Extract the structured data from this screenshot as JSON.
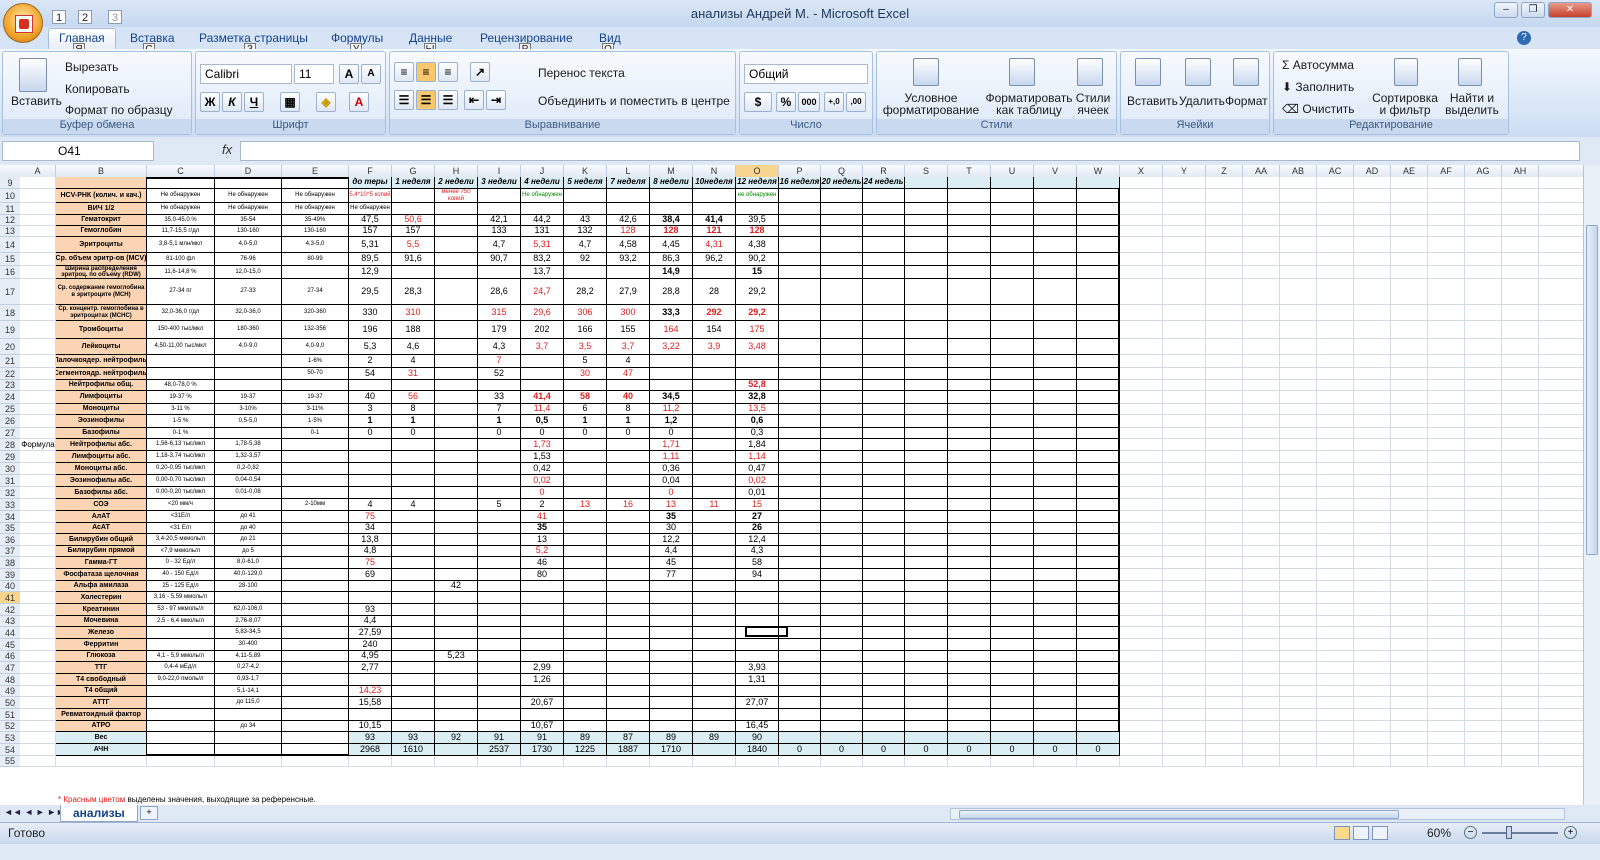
{
  "window": {
    "title": "анализы Андрей М. - Microsoft Excel",
    "qa": [
      "1",
      "2",
      "3"
    ]
  },
  "tabs": [
    {
      "label": "Главная",
      "key": "Я"
    },
    {
      "label": "Вставка",
      "key": "С"
    },
    {
      "label": "Разметка страницы",
      "key": "З"
    },
    {
      "label": "Формулы",
      "key": "У"
    },
    {
      "label": "Данные",
      "key": "Ы"
    },
    {
      "label": "Рецензирование",
      "key": "Р"
    },
    {
      "label": "Вид",
      "key": "О"
    }
  ],
  "ribbon": {
    "clipboard": {
      "paste": "Вставить",
      "cut": "Вырезать",
      "copy": "Копировать",
      "painter": "Формат по образцу",
      "label": "Буфер обмена"
    },
    "font": {
      "name": "Calibri",
      "size": "11",
      "label": "Шрифт",
      "bold": "Ж",
      "italic": "К",
      "underline": "Ч"
    },
    "align": {
      "wrap": "Перенос текста",
      "merge": "Объединить и поместить в центре",
      "label": "Выравнивание"
    },
    "number": {
      "format": "Общий",
      "label": "Число",
      "pct": "%",
      "thousands": "000",
      "inc": "+,0",
      "dec": ",00"
    },
    "styles": {
      "cond": "Условное форматирование",
      "table": "Форматировать как таблицу",
      "cell": "Стили ячеек",
      "label": "Стили"
    },
    "cells": {
      "insert": "Вставить",
      "delete": "Удалить",
      "format": "Формат",
      "label": "Ячейки"
    },
    "editing": {
      "autosum": "Автосумма",
      "fill": "Заполнить",
      "clear": "Очистить",
      "sort": "Сортировка и фильтр",
      "find": "Найти и выделить",
      "label": "Редактирование"
    }
  },
  "formula": {
    "namebox": "O41",
    "fx": "fx",
    "value": ""
  },
  "columns": [
    "A",
    "B",
    "C",
    "D",
    "E",
    "F",
    "G",
    "H",
    "I",
    "J",
    "K",
    "L",
    "M",
    "N",
    "O",
    "P",
    "Q",
    "R",
    "S",
    "T",
    "U",
    "V",
    "W",
    "X",
    "Y",
    "Z",
    "AA",
    "AB",
    "AC",
    "AD",
    "AE",
    "AF",
    "AG",
    "AH"
  ],
  "header_row": [
    "до теры",
    "1 неделя",
    "2 недели",
    "3 недели",
    "4 недели",
    "5 неделя",
    "7 неделя",
    "8 недели",
    "10неделя",
    "12 неделя",
    "16 неделя",
    "20 недель",
    "24 недель"
  ],
  "rows": [
    {
      "n": "10",
      "b": "HCV-РНК (колич. и кач.)",
      "c": "Не обнаружен",
      "d": "Не обнаружен",
      "e": "Не обнаружен",
      "vals": {
        "F": "5,4*10^5 копий",
        "H": "менее 750 копий",
        "J": "Не обнаружен",
        "O": "не обнаружен"
      }
    },
    {
      "n": "11",
      "b": "ВИЧ 1/2",
      "c": "Не обнаружен",
      "d": "Не обнаружен",
      "e": "Не обнаружен",
      "vals": {
        "F": "Не обнаружен"
      }
    },
    {
      "n": "12",
      "b": "Гематокрит",
      "c": "35,0-45,0 %",
      "d": "35-54",
      "e": "35-49%",
      "vals": {
        "F": "47,5",
        "G": "50,6",
        "I": "42,1",
        "J": "44,2",
        "K": "43",
        "L": "42,6",
        "M": "38,4",
        "N": "41,4",
        "O": "39,5"
      }
    },
    {
      "n": "13",
      "b": "Гемоглобин",
      "c": "11,7-15,5 г/дл",
      "d": "130-160",
      "e": "130-160",
      "vals": {
        "F": "157",
        "G": "157",
        "I": "133",
        "J": "131",
        "K": "132",
        "L": "128",
        "M": "128",
        "N": "121",
        "O": "128"
      }
    },
    {
      "n": "14",
      "b": "Эритроциты",
      "c": "3,8-5,1 млн/мкл",
      "d": "4,0-5,0",
      "e": "4,3-5,0",
      "vals": {
        "F": "5,31",
        "G": "5,5",
        "I": "4,7",
        "J": "5,31",
        "K": "4,7",
        "L": "4,58",
        "M": "4,45",
        "N": "4,31",
        "O": "4,38"
      }
    },
    {
      "n": "15",
      "b": "Ср. объем эритр-ов (MCV)",
      "c": "81-100 фл",
      "d": "76-96",
      "e": "80-99",
      "vals": {
        "F": "89,5",
        "G": "91,6",
        "I": "90,7",
        "J": "83,2",
        "K": "92",
        "L": "93,2",
        "M": "86,3",
        "N": "96,2",
        "O": "90,2"
      }
    },
    {
      "n": "16",
      "b": "Ширина распределения эритроц. по объему (RDW)",
      "c": "11,6-14,8 %",
      "d": "12,0-15,0",
      "e": "",
      "vals": {
        "F": "12,9",
        "J": "13,7",
        "M": "14,9",
        "O": "15"
      }
    },
    {
      "n": "17",
      "b": "Ср. содержание гемоглобина в эритроците (MCH)",
      "c": "27-34 пг",
      "d": "27-33",
      "e": "27-34",
      "vals": {
        "F": "29,5",
        "G": "28,3",
        "I": "28,6",
        "J": "24,7",
        "K": "28,2",
        "L": "27,9",
        "M": "28,8",
        "N": "28",
        "O": "29,2"
      }
    },
    {
      "n": "18",
      "b": "Ср. концентр. гемоглобина в эритроцитах (MCHC)",
      "c": "32,0-36,0 г/дл",
      "d": "32,0-36,0",
      "e": "320-360",
      "vals": {
        "F": "330",
        "G": "310",
        "I": "315",
        "J": "29,6",
        "K": "306",
        "L": "300",
        "M": "33,3",
        "N": "292",
        "O": "29,2"
      }
    },
    {
      "n": "19",
      "b": "Тромбоциты",
      "c": "150-400 тыс/мкл",
      "d": "180-360",
      "e": "132-356",
      "vals": {
        "F": "196",
        "G": "188",
        "I": "179",
        "J": "202",
        "K": "166",
        "L": "155",
        "M": "164",
        "N": "154",
        "O": "175"
      }
    },
    {
      "n": "20",
      "b": "Лейкоциты",
      "c": "4,50-11,00 тыс/мкл",
      "d": "4,0-9,0",
      "e": "4,0-9,0",
      "vals": {
        "F": "5,3",
        "G": "4,6",
        "I": "4,3",
        "J": "3,7",
        "K": "3,5",
        "L": "3,7",
        "M": "3,22",
        "N": "3,9",
        "O": "3,48"
      }
    },
    {
      "n": "21",
      "b": "Палочкоядер. нейтрофилы",
      "c": "",
      "d": "",
      "e": "1-6%",
      "vals": {
        "F": "2",
        "G": "4",
        "I": "7",
        "K": "5",
        "L": "4"
      }
    },
    {
      "n": "22",
      "b": "Сегментоядр. нейтрофилы",
      "c": "",
      "d": "",
      "e": "50-70",
      "vals": {
        "F": "54",
        "G": "31",
        "I": "52",
        "K": "30",
        "L": "47"
      }
    },
    {
      "n": "23",
      "b": "Нейтрофилы общ.",
      "c": "48,0-78,0 %",
      "d": "",
      "e": "",
      "vals": {
        "O": "52,8"
      }
    },
    {
      "n": "24",
      "b": "Лимфоциты",
      "c": "19-37 %",
      "d": "19-37",
      "e": "19-37",
      "vals": {
        "F": "40",
        "G": "56",
        "I": "33",
        "J": "41,4",
        "K": "58",
        "L": "40",
        "M": "34,5",
        "O": "32,8"
      }
    },
    {
      "n": "25",
      "b": "Моноциты",
      "c": "3-11 %",
      "d": "3-10%",
      "e": "3-11%",
      "vals": {
        "F": "3",
        "G": "8",
        "I": "7",
        "J": "11,4",
        "K": "6",
        "L": "8",
        "M": "11,2",
        "O": "13,5"
      }
    },
    {
      "n": "26",
      "b": "Эозинофилы",
      "c": "1-5 %",
      "d": "0,5-5,0",
      "e": "1-5%",
      "vals": {
        "F": "1",
        "G": "1",
        "I": "1",
        "J": "0,5",
        "K": "1",
        "L": "1",
        "M": "1,2",
        "O": "0,6"
      }
    },
    {
      "n": "27",
      "b": "Базофилы",
      "c": "0-1 %",
      "d": "",
      "e": "0-1",
      "vals": {
        "F": "0",
        "G": "0",
        "I": "0",
        "J": "0",
        "K": "0",
        "L": "0",
        "M": "0",
        "O": "0,3"
      }
    },
    {
      "n": "28",
      "a": "Формула",
      "b": "Нейтрофилы абс.",
      "c": "1,56-6,13 тыс/мкл",
      "d": "1,78-5,38",
      "e": "",
      "vals": {
        "J": "1,73",
        "M": "1,71",
        "O": "1,84"
      }
    },
    {
      "n": "29",
      "b": "Лимфоциты абс.",
      "c": "1,18-3,74 тыс/мкл",
      "d": "1,32-3,57",
      "e": "",
      "vals": {
        "J": "1,53",
        "M": "1,11",
        "O": "1,14"
      }
    },
    {
      "n": "30",
      "b": "Моноциты абс.",
      "c": "0,20-0,95 тыс/мкл",
      "d": "0,2-0,82",
      "e": "",
      "vals": {
        "J": "0,42",
        "M": "0,36",
        "O": "0,47"
      }
    },
    {
      "n": "31",
      "b": "Эозинофилы абс.",
      "c": "0,00-0,70 тыс/мкл",
      "d": "0,04-0,54",
      "e": "",
      "vals": {
        "J": "0,02",
        "M": "0,04",
        "O": "0,02"
      }
    },
    {
      "n": "32",
      "b": "Базофилы абс.",
      "c": "0,00-0,20 тыс/мкл",
      "d": "0,01-0,08",
      "e": "",
      "vals": {
        "J": "0",
        "M": "0",
        "O": "0,01"
      }
    },
    {
      "n": "33",
      "b": "СОЭ",
      "c": "<20 мм/ч",
      "d": "",
      "e": "2-10мм",
      "vals": {
        "F": "4",
        "G": "4",
        "I": "5",
        "J": "2",
        "K": "13",
        "L": "16",
        "M": "13",
        "N": "11",
        "O": "15"
      }
    },
    {
      "n": "34",
      "b": "АлАТ",
      "c": "<31Е/л",
      "d": "до 41",
      "e": "",
      "vals": {
        "F": "75",
        "J": "41",
        "M": "35",
        "O": "27"
      }
    },
    {
      "n": "35",
      "b": "АсАТ",
      "c": "<31 Е/л",
      "d": "до 40",
      "e": "",
      "vals": {
        "F": "34",
        "J": "35",
        "M": "30",
        "O": "26"
      }
    },
    {
      "n": "36",
      "b": "Билирубин общий",
      "c": "3,4-20,5 мкмоль/л",
      "d": "до 21",
      "e": "",
      "vals": {
        "F": "13,8",
        "J": "13",
        "M": "12,2",
        "O": "12,4"
      }
    },
    {
      "n": "37",
      "b": "Билирубин прямой",
      "c": "<7,9 мкмоль/л",
      "d": "до 5",
      "e": "",
      "vals": {
        "F": "4,8",
        "J": "5,2",
        "M": "4,4",
        "O": "4,3"
      }
    },
    {
      "n": "38",
      "b": "Гамма-ГТ",
      "c": "0 - 32 Ед/л",
      "d": "8,0-61,0",
      "e": "",
      "vals": {
        "F": "75",
        "J": "46",
        "M": "45",
        "O": "58"
      }
    },
    {
      "n": "39",
      "b": "Фосфатаза щелочная",
      "c": "40 - 150 Ед/л",
      "d": "40,0-129,0",
      "e": "",
      "vals": {
        "F": "69",
        "J": "80",
        "M": "77",
        "O": "94"
      }
    },
    {
      "n": "40",
      "b": "Альфа амилаза",
      "c": "25 - 125 Ед/л",
      "d": "28-100",
      "e": "",
      "vals": {
        "H": "42"
      }
    },
    {
      "n": "41",
      "b": "Холестерин",
      "c": "3,16 - 5,59 ммоль/л",
      "d": "",
      "e": "",
      "vals": {}
    },
    {
      "n": "42",
      "b": "Креатинин",
      "c": "53 - 97 мкмоль/л",
      "d": "62,0-106,0",
      "e": "",
      "vals": {
        "F": "93"
      }
    },
    {
      "n": "43",
      "b": "Мочевина",
      "c": "2,5 - 6,4 ммоль/л",
      "d": "2,76-8,07",
      "e": "",
      "vals": {
        "F": "4,4"
      }
    },
    {
      "n": "44",
      "b": "Железо",
      "c": "",
      "d": "5,83-34,5",
      "e": "",
      "vals": {
        "F": "27,59"
      }
    },
    {
      "n": "45",
      "b": "Ферритин",
      "c": "",
      "d": "30-400",
      "e": "",
      "vals": {
        "F": "240"
      }
    },
    {
      "n": "46",
      "b": "Глюкоза",
      "c": "4,1 - 5,9 ммоль/л",
      "d": "4,11-5,89",
      "e": "",
      "vals": {
        "F": "4,95",
        "H": "5,23"
      }
    },
    {
      "n": "47",
      "b": "ТТГ",
      "c": "0,4-4 мЕд/л",
      "d": "0,27-4,2",
      "e": "",
      "vals": {
        "F": "2,77",
        "J": "2,99",
        "O": "3,93"
      }
    },
    {
      "n": "48",
      "b": "Т4 свободный",
      "c": "9,0-22,0 пмоль/л",
      "d": "0,93-1,7",
      "e": "",
      "vals": {
        "J": "1,26",
        "O": "1,31"
      }
    },
    {
      "n": "49",
      "b": "Т4 общий",
      "c": "",
      "d": "5,1-14,1",
      "e": "",
      "vals": {
        "F": "14,23"
      }
    },
    {
      "n": "50",
      "b": "АТТГ",
      "c": "",
      "d": "до 115,0",
      "e": "",
      "vals": {
        "F": "15,58",
        "J": "20,67",
        "O": "27,07"
      }
    },
    {
      "n": "51",
      "b": "Ревматоидный фактор",
      "c": "",
      "d": "",
      "e": "",
      "vals": {}
    },
    {
      "n": "52",
      "b": "АТРО",
      "c": "",
      "d": "до 34",
      "e": "",
      "vals": {
        "F": "10,15",
        "J": "10,67",
        "O": "16,45"
      }
    },
    {
      "n": "53",
      "b": "Вес",
      "c": "",
      "d": "",
      "e": "",
      "vals": {
        "F": "93",
        "G": "93",
        "H": "92",
        "I": "91",
        "J": "91",
        "K": "89",
        "L": "87",
        "M": "89",
        "N": "89",
        "O": "90"
      }
    },
    {
      "n": "54",
      "b": "АЧН",
      "c": "",
      "d": "",
      "e": "",
      "vals": {
        "F": "2968",
        "G": "1610",
        "I": "2537",
        "J": "1730",
        "K": "1225",
        "L": "1887",
        "M": "1710",
        "O": "1840",
        "P": "0",
        "Q": "0",
        "R": "0",
        "S": "0",
        "T": "0",
        "U": "0",
        "V": "0",
        "W": "0"
      }
    }
  ],
  "footnote": {
    "red": "* Красным цветом",
    "rest": " выделены значения, выходящие за референсные."
  },
  "sheet": {
    "name": "анализы"
  },
  "status": {
    "ready": "Готово",
    "zoom": "60%"
  },
  "colors": {
    "label_fill": "#fbd4b4",
    "header_fill": "#dbeef3",
    "red": "#e02020",
    "green": "#008a00"
  }
}
